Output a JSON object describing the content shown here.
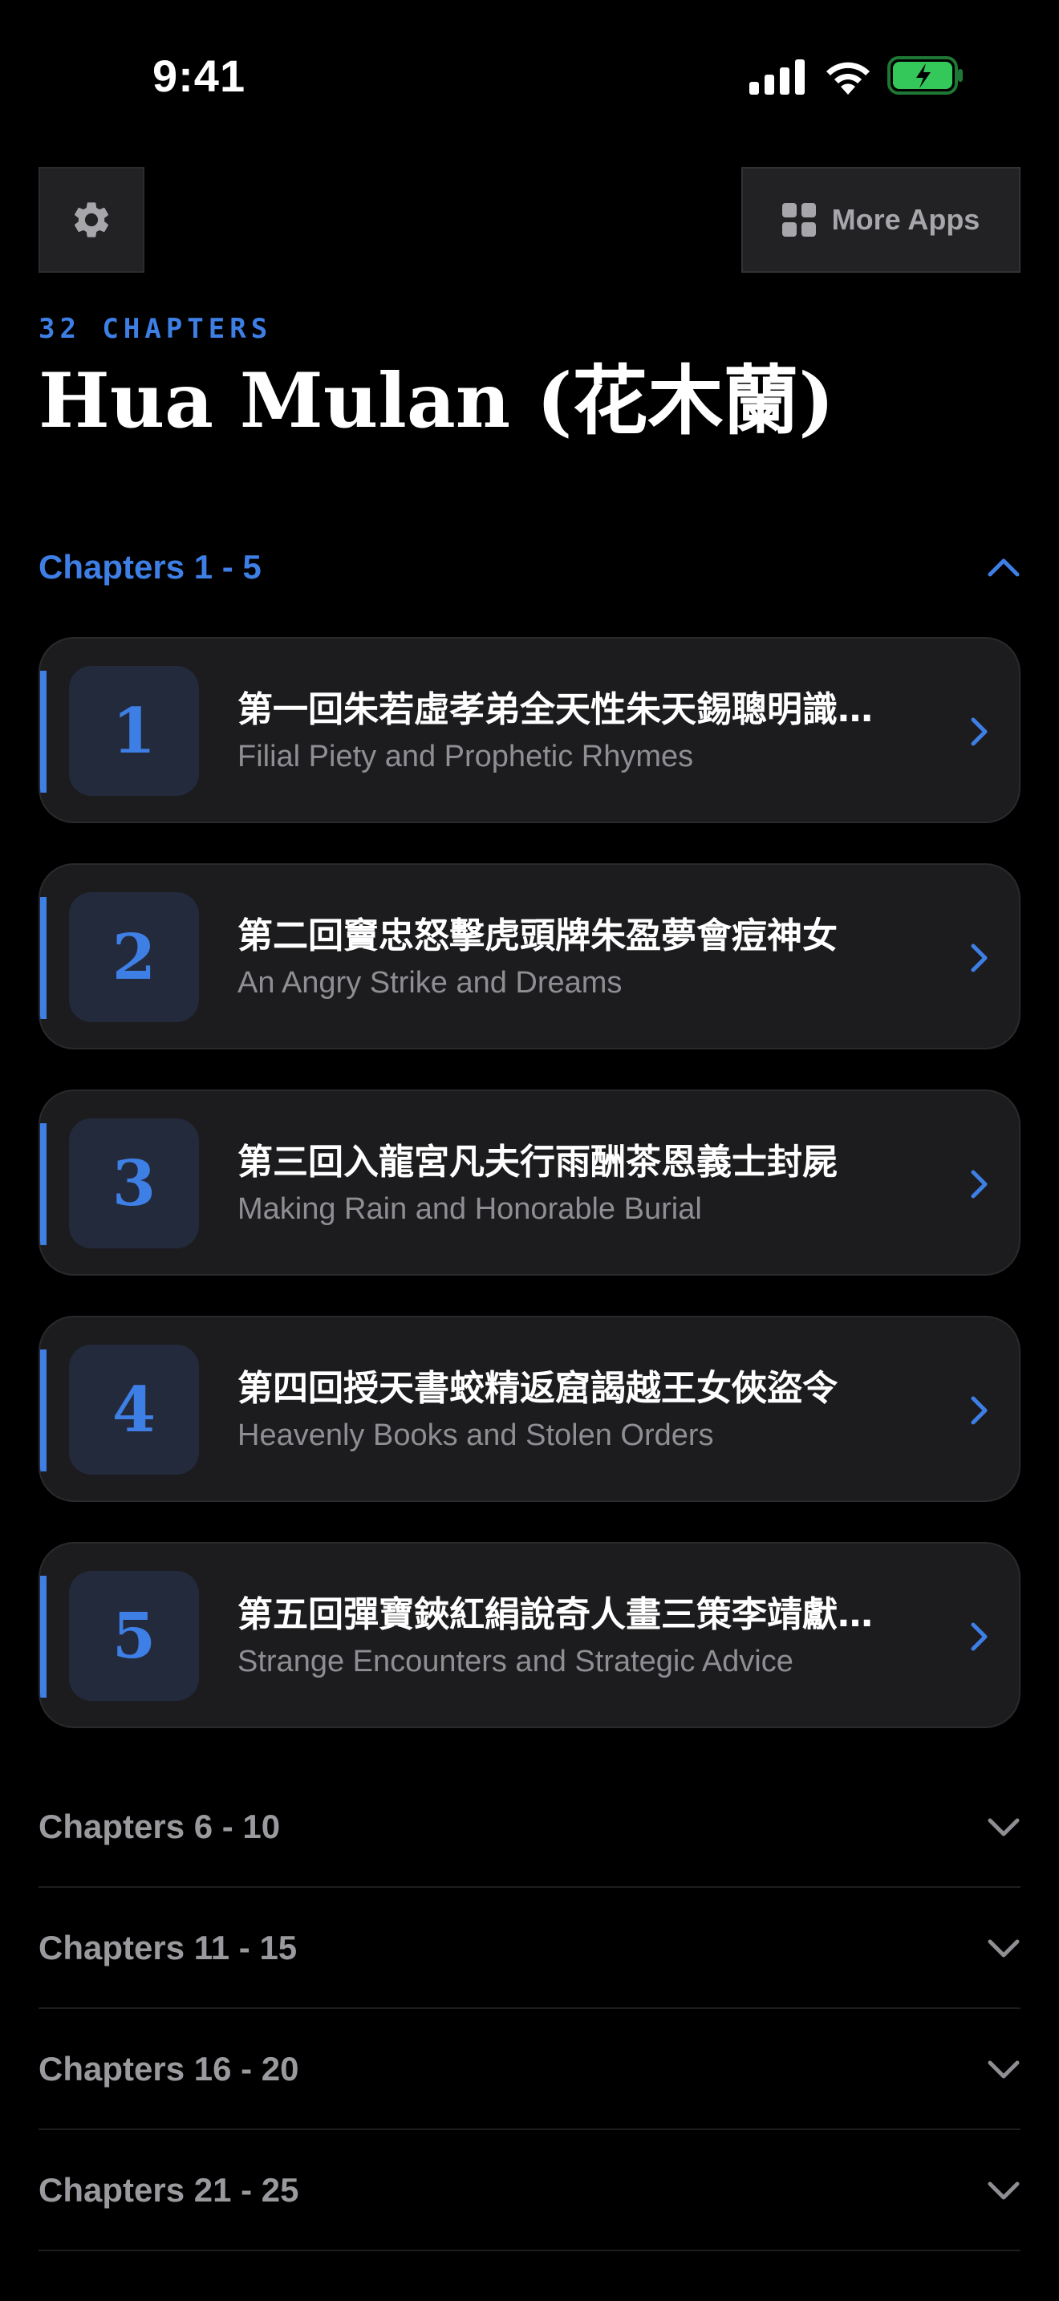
{
  "status_bar": {
    "time": "9:41"
  },
  "top_bar": {
    "settings_icon": "gear-icon",
    "more_apps_icon": "grid-icon",
    "more_apps_label": "More Apps"
  },
  "header": {
    "chapter_count": "32 CHAPTERS",
    "title": "Hua Mulan (花木蘭)"
  },
  "colors": {
    "accent": "#3e7fe6",
    "background": "#000000",
    "card": "#1c1c1e",
    "muted_text": "#8e8e93",
    "battery": "#34c759"
  },
  "sections": [
    {
      "label": "Chapters 1 - 5",
      "expanded": true,
      "chapters": [
        {
          "number": "1",
          "title_zh": "第一回朱若虛孝弟全天性朱天錫聰明識…",
          "title_en": "Filial Piety and Prophetic Rhymes"
        },
        {
          "number": "2",
          "title_zh": "第二回竇忠怒擊虎頭牌朱盈夢會痘神女",
          "title_en": "An Angry Strike and Dreams"
        },
        {
          "number": "3",
          "title_zh": "第三回入龍宮凡夫行雨酬茶恩義士封屍",
          "title_en": "Making Rain and Honorable Burial"
        },
        {
          "number": "4",
          "title_zh": "第四回授天書蛟精返窟謁越王女俠盜令",
          "title_en": "Heavenly Books and Stolen Orders"
        },
        {
          "number": "5",
          "title_zh": "第五回彈寶鋏紅絹說奇人畫三策李靖獻…",
          "title_en": "Strange Encounters and Strategic Advice"
        }
      ]
    },
    {
      "label": "Chapters 6 - 10",
      "expanded": false
    },
    {
      "label": "Chapters 11 - 15",
      "expanded": false
    },
    {
      "label": "Chapters 16 - 20",
      "expanded": false
    },
    {
      "label": "Chapters 21 - 25",
      "expanded": false
    }
  ]
}
